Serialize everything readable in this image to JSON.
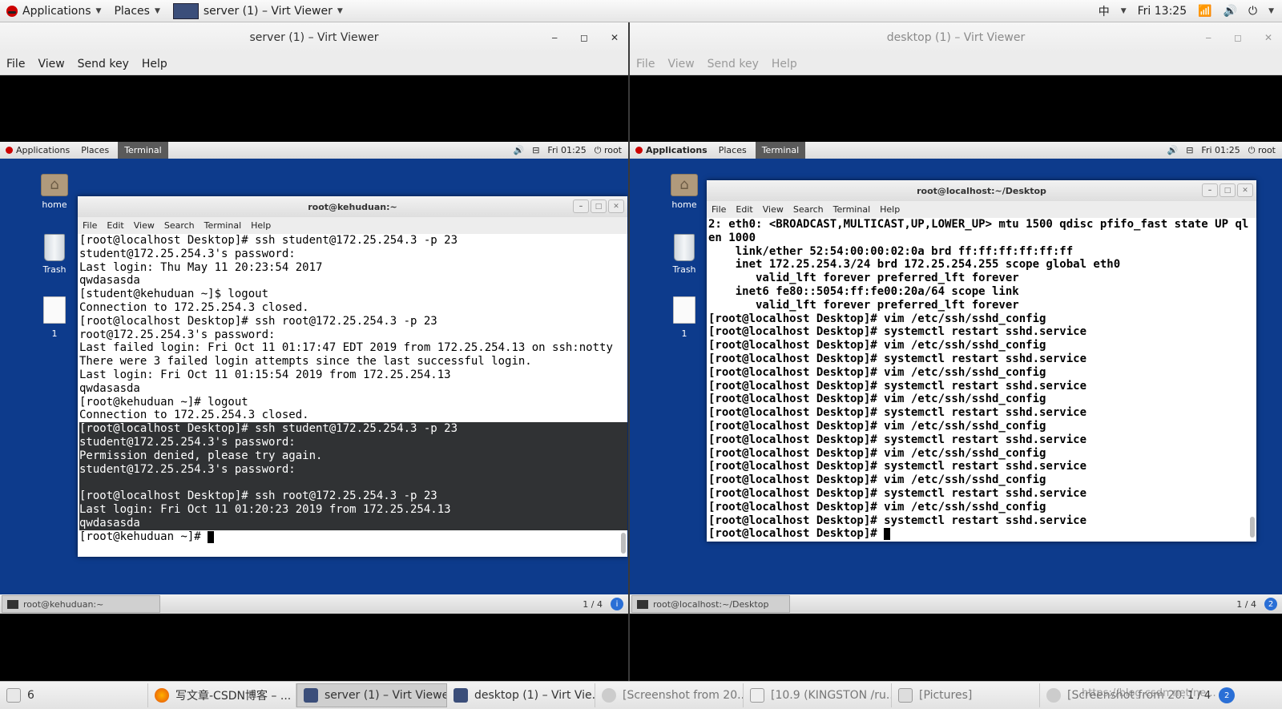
{
  "host_topbar": {
    "applications": "Applications",
    "places": "Places",
    "window": "server (1) – Virt Viewer",
    "input_method": "中",
    "clock": "Fri 13:25"
  },
  "server_window": {
    "title": "server (1) – Virt Viewer",
    "menu": [
      "File",
      "View",
      "Send key",
      "Help"
    ],
    "guest_topbar": {
      "applications": "Applications",
      "places": "Places",
      "terminal": "Terminal",
      "clock": "Fri 01:25",
      "user": "root"
    },
    "desktop_icons": [
      "home",
      "Trash",
      "1"
    ],
    "terminal_title": "root@kehuduan:~",
    "terminal_menu": [
      "File",
      "Edit",
      "View",
      "Search",
      "Terminal",
      "Help"
    ],
    "lines": [
      "[root@localhost Desktop]# ssh student@172.25.254.3 -p 23",
      "student@172.25.254.3's password:",
      "Last login: Thu May 11 20:23:54 2017",
      "qwdasasda",
      "[student@kehuduan ~]$ logout",
      "Connection to 172.25.254.3 closed.",
      "[root@localhost Desktop]# ssh root@172.25.254.3 -p 23",
      "root@172.25.254.3's password:",
      "Last failed login: Fri Oct 11 01:17:47 EDT 2019 from 172.25.254.13 on ssh:notty",
      "There were 3 failed login attempts since the last successful login.",
      "Last login: Fri Oct 11 01:15:54 2019 from 172.25.254.13",
      "qwdasasda",
      "[root@kehuduan ~]# logout",
      "Connection to 172.25.254.3 closed.",
      "[root@localhost Desktop]# ssh student@172.25.254.3 -p 23",
      "student@172.25.254.3's password:",
      "Permission denied, please try again.",
      "student@172.25.254.3's password:",
      "",
      "[root@localhost Desktop]# ssh root@172.25.254.3 -p 23",
      "Last login: Fri Oct 11 01:20:23 2019 from 172.25.254.13",
      "qwdasasda",
      "[root@kehuduan ~]# "
    ],
    "selected_lines": [
      14,
      15,
      16,
      17,
      18,
      19,
      20,
      21
    ],
    "guest_task": "root@kehuduan:~",
    "workspace": "1 / 4"
  },
  "desktop_window": {
    "title": "desktop (1) – Virt Viewer",
    "menu": [
      "File",
      "View",
      "Send key",
      "Help"
    ],
    "guest_topbar": {
      "applications": "Applications",
      "places": "Places",
      "terminal": "Terminal",
      "clock": "Fri 01:25",
      "user": "root"
    },
    "desktop_icons": [
      "home",
      "Trash",
      "1"
    ],
    "terminal_title": "root@localhost:~/Desktop",
    "terminal_menu": [
      "File",
      "Edit",
      "View",
      "Search",
      "Terminal",
      "Help"
    ],
    "lines": [
      "2: eth0: <BROADCAST,MULTICAST,UP,LOWER_UP> mtu 1500 qdisc pfifo_fast state UP ql",
      "en 1000",
      "    link/ether 52:54:00:00:02:0a brd ff:ff:ff:ff:ff:ff",
      "    inet 172.25.254.3/24 brd 172.25.254.255 scope global eth0",
      "       valid_lft forever preferred_lft forever",
      "    inet6 fe80::5054:ff:fe00:20a/64 scope link",
      "       valid_lft forever preferred_lft forever",
      "[root@localhost Desktop]# vim /etc/ssh/sshd_config",
      "[root@localhost Desktop]# systemctl restart sshd.service",
      "[root@localhost Desktop]# vim /etc/ssh/sshd_config",
      "[root@localhost Desktop]# systemctl restart sshd.service",
      "[root@localhost Desktop]# vim /etc/ssh/sshd_config",
      "[root@localhost Desktop]# systemctl restart sshd.service",
      "[root@localhost Desktop]# vim /etc/ssh/sshd_config",
      "[root@localhost Desktop]# systemctl restart sshd.service",
      "[root@localhost Desktop]# vim /etc/ssh/sshd_config",
      "[root@localhost Desktop]# systemctl restart sshd.service",
      "[root@localhost Desktop]# vim /etc/ssh/sshd_config",
      "[root@localhost Desktop]# systemctl restart sshd.service",
      "[root@localhost Desktop]# vim /etc/ssh/sshd_config",
      "[root@localhost Desktop]# systemctl restart sshd.service",
      "[root@localhost Desktop]# vim /etc/ssh/sshd_config",
      "[root@localhost Desktop]# systemctl restart sshd.service",
      "[root@localhost Desktop]# "
    ],
    "guest_task": "root@localhost:~/Desktop",
    "workspace": "1 / 4"
  },
  "host_taskbar": {
    "workspaces_count": "6",
    "items": [
      "写文章-CSDN博客 – ...",
      "server (1) – Virt Viewer",
      "desktop (1) – Virt Vie...",
      "[Screenshot from 20...",
      "[10.9 (KINGSTON /ru...",
      "[Pictures]",
      "[Screenshot from 20..."
    ],
    "workspace": "1 / 4",
    "watermark": "https://blog.csdn.net/ne..."
  }
}
